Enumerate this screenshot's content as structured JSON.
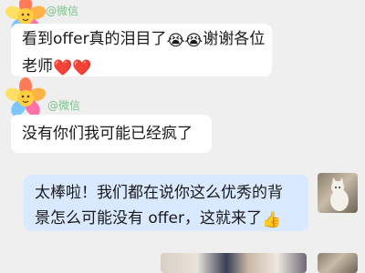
{
  "messages": [
    {
      "sender": "left",
      "source_label": "@微信",
      "parts": [
        "看到offer真的泪目了",
        "😭😭",
        "谢谢各位",
        "老师",
        "❤️❤️"
      ]
    },
    {
      "sender": "left",
      "source_label": "@微信",
      "text": "没有你们我可能已经疯了"
    },
    {
      "sender": "right",
      "line1": "太棒啦！我们都在说你这么优秀的背",
      "line2": "景怎么可能没有 offer，这就来了",
      "emoji": "👍"
    }
  ],
  "icons": {
    "sender_avatar": "flower-sticker-avatar",
    "reply_avatar": "cat-photo-avatar"
  },
  "colors": {
    "background": "#efefef",
    "left_bubble": "#ffffff",
    "right_bubble": "#d9e9ff",
    "source_tag": "#7fc08f"
  }
}
